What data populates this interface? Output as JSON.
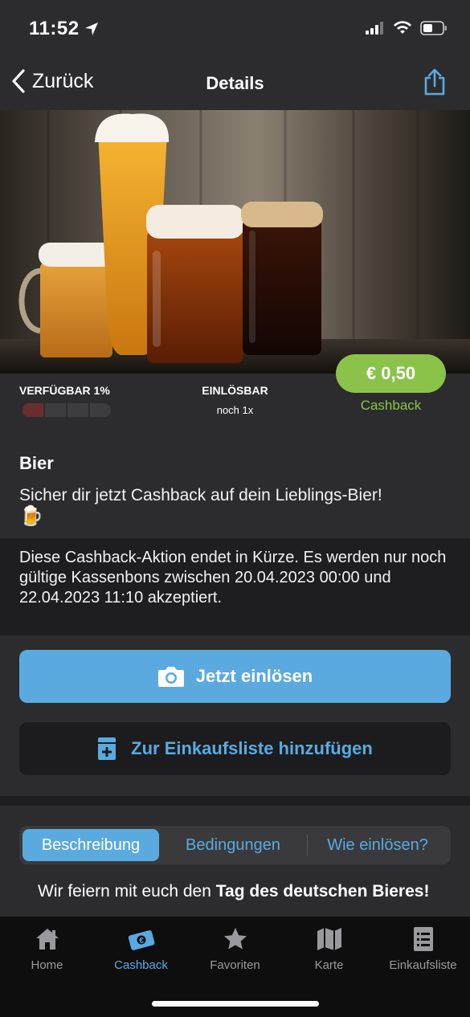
{
  "status": {
    "time": "11:52"
  },
  "nav": {
    "back_label": "Zurück",
    "title": "Details"
  },
  "offer": {
    "available_label": "VERFÜGBAR 1%",
    "available_fraction": 0.01,
    "redeemable_label": "EINLÖSBAR",
    "redeemable_count": "noch 1x",
    "price": "€ 0,50",
    "price_caption": "Cashback"
  },
  "product": {
    "name": "Bier",
    "description": "Sicher dir jetzt Cashback auf dein Lieblings-Bier!",
    "emoji": "🍺"
  },
  "notice": {
    "text": "Diese Cashback-Aktion endet in Kürze. Es werden nur noch gültige Kassenbons zwischen 20.04.2023 00:00 und 22.04.2023 11:10 akzeptiert."
  },
  "actions": {
    "redeem_label": "Jetzt einlösen",
    "add_to_list_label": "Zur Einkaufsliste hinzufügen"
  },
  "segments": [
    "Beschreibung",
    "Bedingungen",
    "Wie einlösen?"
  ],
  "description": {
    "intro": "Wir feiern mit euch den ",
    "highlight": "Tag des deutschen Bieres!"
  },
  "tabbar": [
    {
      "label": "Home",
      "icon": "home-icon"
    },
    {
      "label": "Cashback",
      "icon": "cashback-icon",
      "active": true
    },
    {
      "label": "Favoriten",
      "icon": "star-icon"
    },
    {
      "label": "Karte",
      "icon": "map-icon"
    },
    {
      "label": "Einkaufsliste",
      "icon": "shopping-list-icon"
    }
  ],
  "colors": {
    "accent": "#5aaae0",
    "price_green": "#8bc34a",
    "background": "#2c2c2e"
  }
}
